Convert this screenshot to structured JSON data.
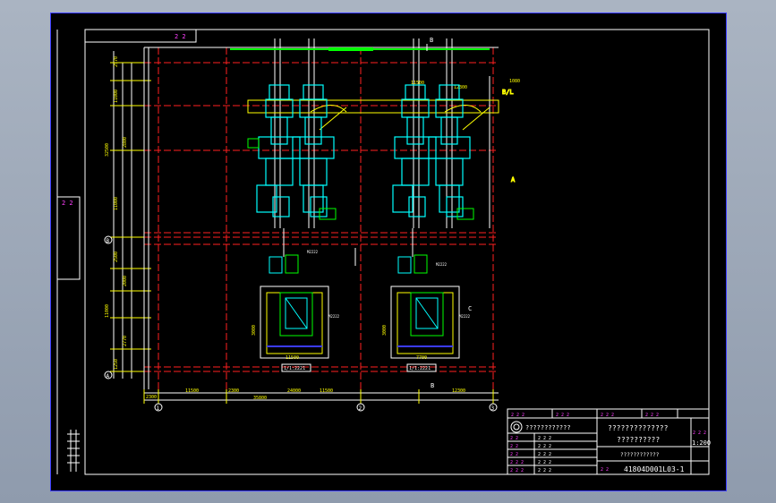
{
  "drawing": {
    "top_marks": "2 2",
    "left_label": "2 2",
    "section_markers": {
      "top_b": "B",
      "bottom_b": "B",
      "side_c": "C",
      "side_a": "A",
      "side_bl": "B/L"
    },
    "axis_marks": {
      "axis_1": "1",
      "axis_2": "2",
      "axis_3": "3"
    },
    "left_rows": {
      "row_b": "B",
      "row_a": "A"
    },
    "plan_labels": {
      "left": "1/1:2221",
      "right": "1/1:2221"
    },
    "dims_bottom": [
      "2300",
      "11500",
      "2300",
      "11500",
      "12300"
    ],
    "dims_bottom_total": [
      "35800",
      "24000"
    ],
    "dims_left": [
      "2570",
      "11000",
      "32500",
      "2800",
      "11000",
      "2500",
      "2000",
      "11000",
      "2770",
      "1250"
    ],
    "dims_top_right": [
      "11500",
      "12300",
      "1080"
    ],
    "equip_tags": [
      "M2222",
      "M2222",
      "M2222",
      "M2222"
    ],
    "plan_dims": [
      "11500",
      "7700",
      "3000",
      "3000"
    ]
  },
  "title_block": {
    "header_cells": [
      "2 2 2",
      "2 2 2",
      "2 2 2",
      "2 2 2"
    ],
    "project_name": "????????????",
    "drawing_title_1": "??????????????",
    "drawing_title_2": "??????????",
    "subtitle": "????????????",
    "scale": "1:200",
    "scale_label": "2 2 2",
    "drawing_number": "41804D001L03-1",
    "left_rows": [
      "2 2",
      "2 2",
      "2 2",
      "2 2 2",
      "2 2 2"
    ],
    "left_values": [
      "2 2 2",
      "2 2 2",
      "2 2 2",
      "2 2 2",
      "2 2 2"
    ],
    "number_label": "2 2"
  },
  "colors": {
    "sheet": "#000000",
    "frame": "#3b3bff",
    "red_axis": "#ff2020",
    "yellow_dim": "#ffff00",
    "cyan_equip": "#00ffff",
    "green_struct": "#00ff00",
    "white_line": "#ffffff",
    "magenta_text": "#ff40ff"
  }
}
